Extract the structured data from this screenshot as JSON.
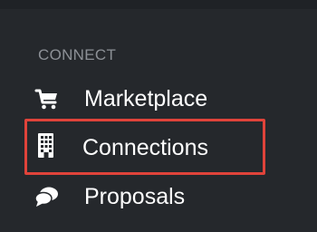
{
  "sidebar": {
    "section_header": "CONNECT",
    "items": [
      {
        "label": "Marketplace",
        "icon": "shopping-cart-icon"
      },
      {
        "label": "Connections",
        "icon": "building-icon",
        "highlighted": true
      },
      {
        "label": "Proposals",
        "icon": "chat-bubbles-icon"
      }
    ]
  },
  "colors": {
    "sidebar_bg": "#25282c",
    "header_text": "#8c9096",
    "item_text": "#ffffff",
    "highlight": "#e0433a"
  }
}
